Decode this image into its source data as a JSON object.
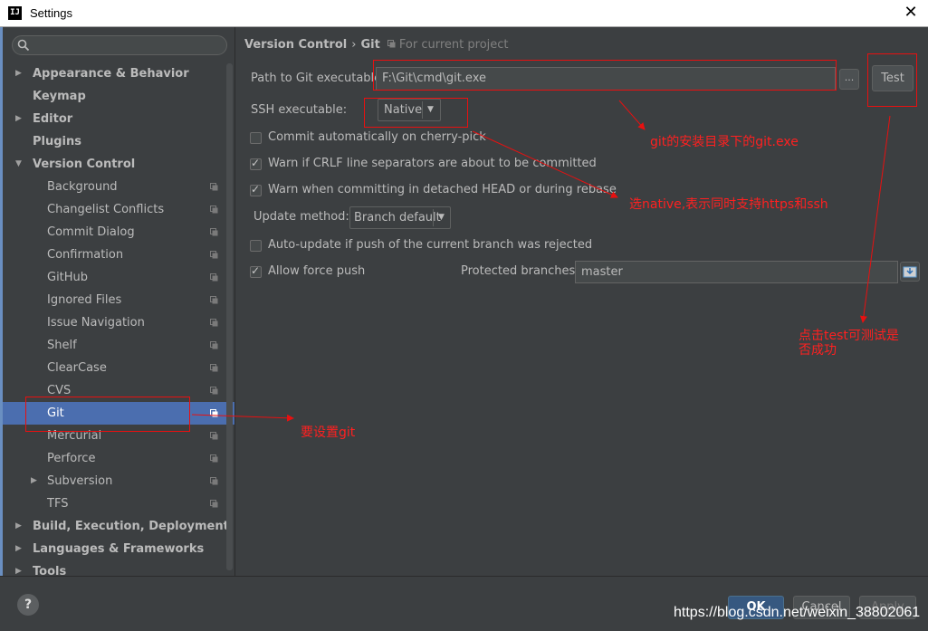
{
  "window": {
    "title": "Settings",
    "app_icon": "IJ"
  },
  "sidebar": {
    "search": {
      "placeholder": ""
    },
    "items": [
      {
        "label": "Appearance & Behavior",
        "level": 0,
        "arrow": "right"
      },
      {
        "label": "Keymap",
        "level": 0
      },
      {
        "label": "Editor",
        "level": 0,
        "arrow": "right"
      },
      {
        "label": "Plugins",
        "level": 0
      },
      {
        "label": "Version Control",
        "level": 0,
        "arrow": "down"
      },
      {
        "label": "Background",
        "level": 1,
        "proj": true
      },
      {
        "label": "Changelist Conflicts",
        "level": 1,
        "proj": true
      },
      {
        "label": "Commit Dialog",
        "level": 1,
        "proj": true
      },
      {
        "label": "Confirmation",
        "level": 1,
        "proj": true
      },
      {
        "label": "GitHub",
        "level": 1,
        "proj": true
      },
      {
        "label": "Ignored Files",
        "level": 1,
        "proj": true
      },
      {
        "label": "Issue Navigation",
        "level": 1,
        "proj": true
      },
      {
        "label": "Shelf",
        "level": 1,
        "proj": true
      },
      {
        "label": "ClearCase",
        "level": 1,
        "proj": true
      },
      {
        "label": "CVS",
        "level": 1,
        "proj": true
      },
      {
        "label": "Git",
        "level": 1,
        "proj": true,
        "selected": true
      },
      {
        "label": "Mercurial",
        "level": 1,
        "proj": true
      },
      {
        "label": "Perforce",
        "level": 1,
        "proj": true
      },
      {
        "label": "Subversion",
        "level": 1,
        "proj": true,
        "arrow": "right"
      },
      {
        "label": "TFS",
        "level": 1,
        "proj": true
      },
      {
        "label": "Build, Execution, Deployment",
        "level": 0,
        "arrow": "right"
      },
      {
        "label": "Languages & Frameworks",
        "level": 0,
        "arrow": "right"
      },
      {
        "label": "Tools",
        "level": 0,
        "arrow": "right"
      }
    ]
  },
  "breadcrumb": {
    "parent": "Version Control",
    "separator": "›",
    "current": "Git",
    "scope": "For current project"
  },
  "git": {
    "path_label": "Path to Git executable:",
    "path_value": "F:\\Git\\cmd\\git.exe",
    "browse_label": "...",
    "test_label": "Test",
    "ssh_label": "SSH executable:",
    "ssh_value": "Native",
    "commit_cherry_label": "Commit automatically on cherry-pick",
    "commit_cherry_checked": false,
    "crlf_label": "Warn if CRLF line separators are about to be committed",
    "crlf_checked": true,
    "detached_label": "Warn when committing in detached HEAD or during rebase",
    "detached_checked": true,
    "update_method_label": "Update method:",
    "update_method_value": "Branch default",
    "autoupdate_label": "Auto-update if push of the current branch was rejected",
    "autoupdate_checked": false,
    "force_push_label": "Allow force push",
    "force_push_checked": true,
    "protected_label": "Protected branches:",
    "protected_value": "master"
  },
  "footer": {
    "ok": "OK",
    "cancel": "Cancel",
    "apply": "Apply",
    "help": "?"
  },
  "annotations": {
    "git_exe": "git的安装目录下的git.exe",
    "native": "选native,表示同时支持https和ssh",
    "test_line1": "点击test可测试是",
    "test_line2": "否成功",
    "set_git": "要设置git"
  },
  "watermark": "https://blog.csdn.net/weixin_38802061",
  "colors": {
    "annotation_red": "#e81010",
    "selection": "#4b6eaf",
    "background": "#3c3f41"
  }
}
